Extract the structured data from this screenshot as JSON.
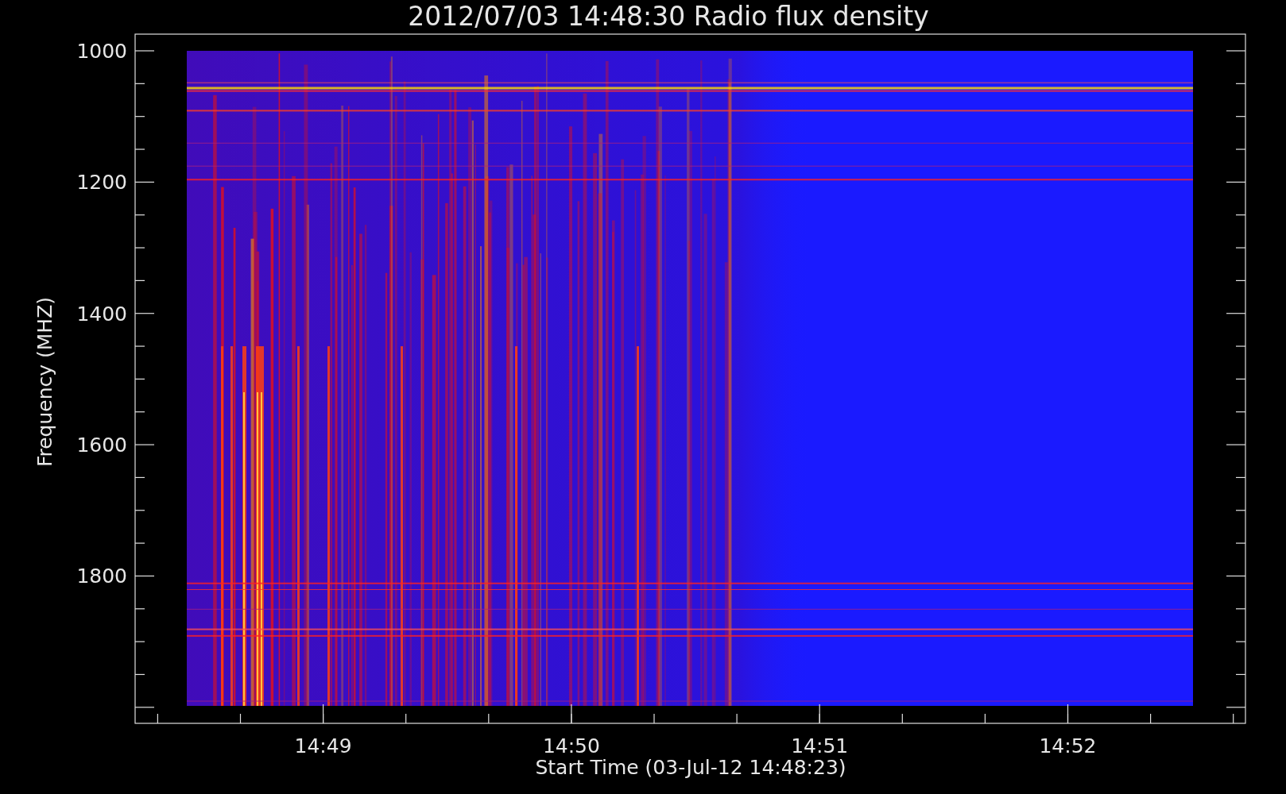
{
  "plot": {
    "title": "2012/07/03 14:48:30 Radio flux density",
    "xlabel": "Start Time (03-Jul-12 14:48:23)",
    "ylabel": "Frequency (MHZ)",
    "x_tick_labels": [
      "14:49",
      "14:50",
      "14:51",
      "14:52"
    ],
    "y_tick_labels": [
      "1000",
      "1200",
      "1400",
      "1600",
      "1800"
    ]
  }
}
